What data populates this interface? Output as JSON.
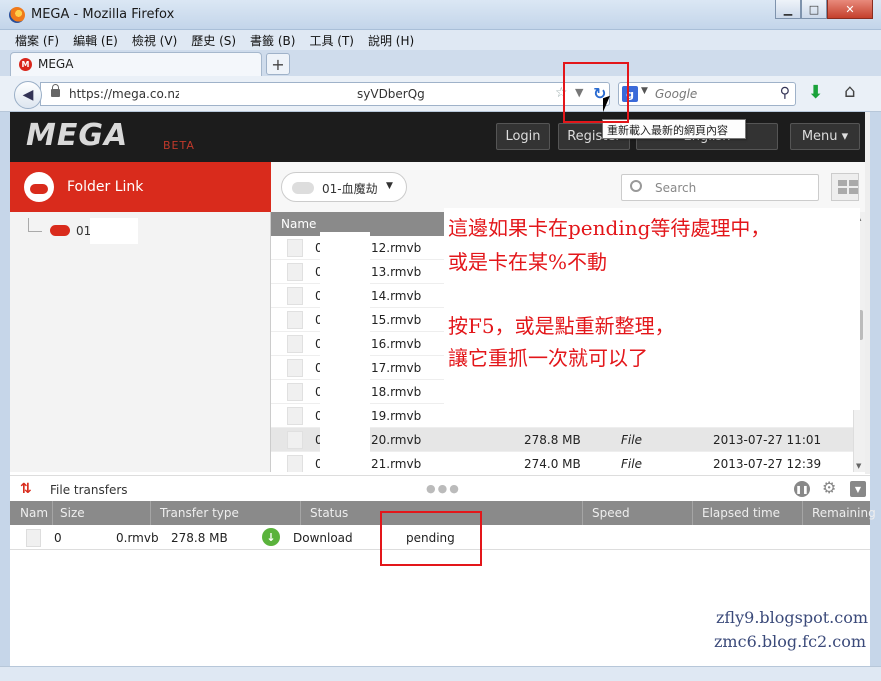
{
  "window": {
    "title": "MEGA - Mozilla Firefox",
    "controls": {
      "minimize": "▁",
      "maximize": "□",
      "close": "✕"
    }
  },
  "menubar": {
    "items": [
      "檔案 (F)",
      "編輯 (E)",
      "檢視 (V)",
      "歷史 (S)",
      "書籤 (B)",
      "工具 (T)",
      "說明 (H)"
    ]
  },
  "tabs": [
    {
      "label": "MEGA"
    }
  ],
  "new_tab_label": "+",
  "navbar": {
    "url_prefix": "https://mega.co.nz/",
    "url_suffix": "syVDberQg",
    "search_placeholder": "Google",
    "search_engine_icon": "g-icon",
    "tooltip": "重新載入最新的網頁內容"
  },
  "mega": {
    "logo": "MEGA",
    "beta": "BETA",
    "header_buttons": {
      "login": "Login",
      "register": "Register",
      "language": "English",
      "menu": "Menu"
    },
    "folder_link_label": "Folder Link",
    "tree_root_label": "01",
    "folder_dropdown_label": "01-血魔劫",
    "search_placeholder": "Search",
    "list_header_name": "Name",
    "files": [
      {
        "prefix": "0",
        "name": "12.rmvb",
        "size": "",
        "type": "",
        "date": ""
      },
      {
        "prefix": "0",
        "name": "13.rmvb",
        "size": "",
        "type": "",
        "date": ""
      },
      {
        "prefix": "0",
        "name": "14.rmvb",
        "size": "",
        "type": "",
        "date": ""
      },
      {
        "prefix": "0",
        "name": "15.rmvb",
        "size": "",
        "type": "",
        "date": ""
      },
      {
        "prefix": "0",
        "name": "16.rmvb",
        "size": "",
        "type": "",
        "date": ""
      },
      {
        "prefix": "0",
        "name": "17.rmvb",
        "size": "",
        "type": "",
        "date": ""
      },
      {
        "prefix": "0",
        "name": "18.rmvb",
        "size": "",
        "type": "",
        "date": ""
      },
      {
        "prefix": "0",
        "name": "19.rmvb",
        "size": "",
        "type": "",
        "date": ""
      },
      {
        "prefix": "0",
        "name": "20.rmvb",
        "size": "278.8 MB",
        "type": "File",
        "date": "2013-07-27 11:01"
      },
      {
        "prefix": "0",
        "name": "21.rmvb",
        "size": "274.0 MB",
        "type": "File",
        "date": "2013-07-27 12:39"
      }
    ],
    "selected_row_index": 8
  },
  "transfers": {
    "label": "File transfers",
    "columns": [
      "Nam",
      "Size",
      "Transfer type",
      "Status",
      "Speed",
      "Elapsed time",
      "Remaining"
    ],
    "row": {
      "prefix": "0",
      "name": "0.rmvb",
      "size": "278.8 MB",
      "type": "Download",
      "status": "pending"
    }
  },
  "annotation": {
    "lines": [
      "這邊如果卡在pending等待處理中，",
      "或是卡在某%不動",
      "按F5，或是點重新整理，",
      "讓它重抓一次就可以了"
    ]
  },
  "watermarks": [
    "zfly9.blogspot.com",
    "zmc6.blog.fc2.com"
  ],
  "colors": {
    "mega_red": "#d92b1c",
    "annotation_red": "#e3161a",
    "header_dark": "#1c1c1c"
  }
}
